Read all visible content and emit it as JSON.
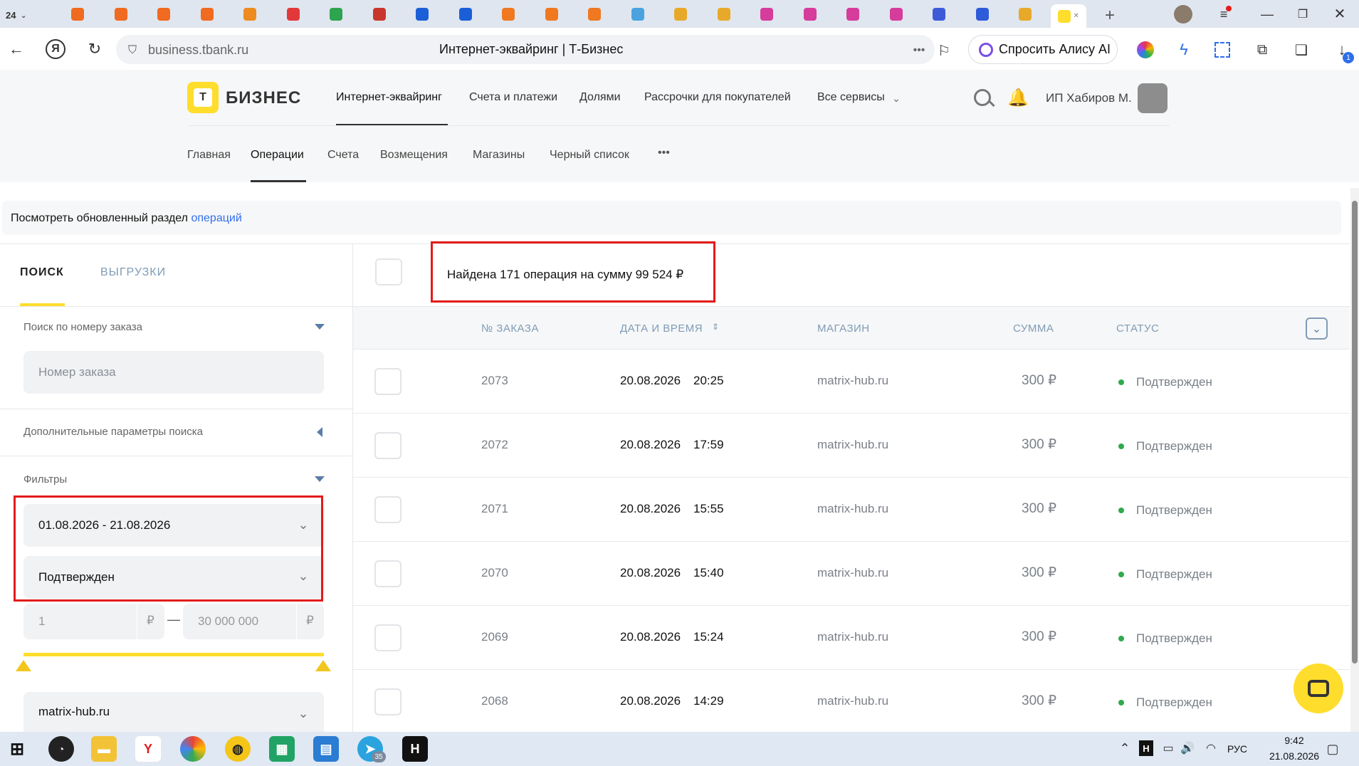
{
  "browser": {
    "tab_counter": "24",
    "url": "business.tbank.ru",
    "page_title": "Интернет-эквайринг | Т-Бизнес",
    "alice_label": "Спросить Алису AI",
    "downloads_badge": "1",
    "tab_colors": [
      "#f06a1f",
      "#f06a1f",
      "#f06a1f",
      "#f06a1f",
      "#ee8b1f",
      "#e2383a",
      "#2ea44f",
      "#c8372d",
      "#1b5fd8",
      "#1b5fd8",
      "#f07820",
      "#f07820",
      "#f07820",
      "#4aa3df",
      "#e8a92a",
      "#e8a92a",
      "#d63c9c",
      "#d63c9c",
      "#d63c9c",
      "#d63c9c",
      "#3d5bd9",
      "#2e5bd9",
      "#e8a92a",
      "#ffdd2d"
    ]
  },
  "header": {
    "logo_text": "БИЗНЕС",
    "logo_mark": "T",
    "nav": [
      "Интернет-эквайринг",
      "Счета и платежи",
      "Долями",
      "Рассрочки для покупателей",
      "Все сервисы"
    ],
    "user_name": "ИП Хабиров М."
  },
  "subnav": {
    "items": [
      "Главная",
      "Операции",
      "Счета",
      "Возмещения",
      "Магазины",
      "Черный список"
    ],
    "more": "•••",
    "active": "Операции"
  },
  "banner": {
    "text": "Посмотреть обновленный раздел",
    "link": "операций"
  },
  "left": {
    "tabs": [
      "ПОИСК",
      "ВЫГРУЗКИ"
    ],
    "order_search_label": "Поиск по номеру заказа",
    "order_placeholder": "Номер заказа",
    "extra_params_label": "Дополнительные параметры поиска",
    "filters_label": "Фильтры",
    "date_range": "01.08.2026 - 21.08.2026",
    "status_value": "Подтвержден",
    "amount_from": "1",
    "amount_to": "30 000 000",
    "currency": "₽",
    "amount_separator": "—",
    "shop_value": "matrix-hub.ru"
  },
  "results": {
    "summary": "Найдена 171 операция на сумму 99 524 ₽",
    "columns": [
      "№ ЗАКАЗА",
      "ДАТА И ВРЕМЯ",
      "МАГАЗИН",
      "СУММА",
      "СТАТУС"
    ],
    "sort_icon": "⇕",
    "rows": [
      {
        "order": "2073",
        "date": "20.08.2026",
        "time": "20:25",
        "shop": "matrix-hub.ru",
        "amount": "300 ₽",
        "status": "Подтвержден"
      },
      {
        "order": "2072",
        "date": "20.08.2026",
        "time": "17:59",
        "shop": "matrix-hub.ru",
        "amount": "300 ₽",
        "status": "Подтвержден"
      },
      {
        "order": "2071",
        "date": "20.08.2026",
        "time": "15:55",
        "shop": "matrix-hub.ru",
        "amount": "300 ₽",
        "status": "Подтвержден"
      },
      {
        "order": "2070",
        "date": "20.08.2026",
        "time": "15:40",
        "shop": "matrix-hub.ru",
        "amount": "300 ₽",
        "status": "Подтвержден"
      },
      {
        "order": "2069",
        "date": "20.08.2026",
        "time": "15:24",
        "shop": "matrix-hub.ru",
        "amount": "300 ₽",
        "status": "Подтвержден"
      },
      {
        "order": "2068",
        "date": "20.08.2026",
        "time": "14:29",
        "shop": "matrix-hub.ru",
        "amount": "300 ₽",
        "status": "Подтвержден"
      }
    ]
  },
  "taskbar": {
    "lang": "РУС",
    "time": "9:42",
    "date": "21.08.2026",
    "telegram_badge": "35",
    "hotkey_letter": "H",
    "yandex_letter": "Y"
  },
  "colors": {
    "accent": "#ffdd2d",
    "link": "#336fee",
    "red_box": "#e31b1b",
    "status_green": "#2eaa4c"
  }
}
